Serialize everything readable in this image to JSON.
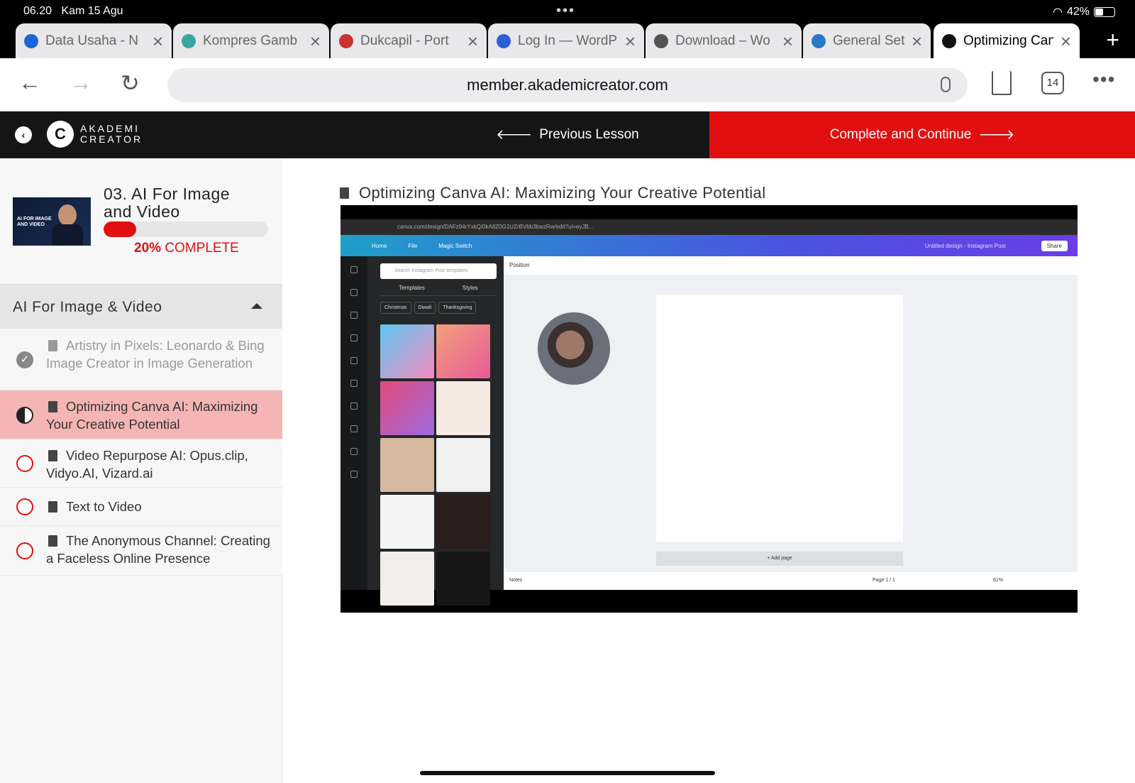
{
  "status": {
    "time": "06.20",
    "date": "Kam 15 Agu",
    "battery": "42%",
    "battery_level": 0.42
  },
  "browser": {
    "tabs": [
      {
        "label": "Data Usaha - N",
        "favicon_color": "#1a66d8"
      },
      {
        "label": "Kompres Gamb",
        "favicon_color": "#3aa6a0"
      },
      {
        "label": "Dukcapil - Port",
        "favicon_color": "#c8332f"
      },
      {
        "label": "Log In — WordP",
        "favicon_color": "#2b5fd9"
      },
      {
        "label": "Download – Wo",
        "favicon_color": "#555555"
      },
      {
        "label": "General Setti",
        "favicon_color": "#2a79c7"
      },
      {
        "label": "Optimizing Can",
        "favicon_color": "#111111",
        "active": true
      }
    ],
    "url": "member.akademicreator.com",
    "tab_count": "14"
  },
  "header": {
    "logo_line1": "AKADEMI",
    "logo_line2": "CREATOR",
    "prev_label": "Previous Lesson",
    "complete_label": "Complete and Continue",
    "accent": "#e10f0f"
  },
  "course": {
    "title": "03. AI For Image and Video",
    "thumb_text": "AI FOR IMAGE AND VIDEO",
    "progress_pct": "20%",
    "progress_word": "COMPLETE",
    "progress_value": 0.2
  },
  "section": {
    "title": "AI For Image & Video"
  },
  "lessons": [
    {
      "title": "Artistry in Pixels: Leonardo & Bing Image Creator in Image Generation",
      "state": "done"
    },
    {
      "title": "Optimizing Canva AI: Maximizing Your Creative Potential",
      "state": "active"
    },
    {
      "title": "Video Repurpose AI: Opus.clip, Vidyo.AI, Vizard.ai",
      "state": "todo"
    },
    {
      "title": "Text to Video",
      "state": "todo"
    },
    {
      "title": "The Anonymous Channel: Creating a Faceless Online Presence",
      "state": "todo"
    }
  ],
  "main": {
    "lesson_title": "Optimizing Canva AI: Maximizing Your Creative Potential"
  },
  "video": {
    "url_text": "canva.com/design/DAFz94rYxkQ/0kA8Z0G1UZrBVbb3bwzRw/edit?ui=eyJB...",
    "toolbar": [
      "Home",
      "File",
      "Magic Switch"
    ],
    "doc_name": "Untitled design - Instagram Post",
    "share_label": "Share",
    "search_placeholder": "Search Instagram Post templates",
    "panel_tabs": [
      "Templates",
      "Styles"
    ],
    "chips": [
      "Christmas",
      "Diwali",
      "Thanksgiving"
    ],
    "position_label": "Position",
    "add_page_label": "+ Add page",
    "notes_label": "Notes",
    "page_label": "Page 1 / 1",
    "zoom_label": "61%"
  }
}
